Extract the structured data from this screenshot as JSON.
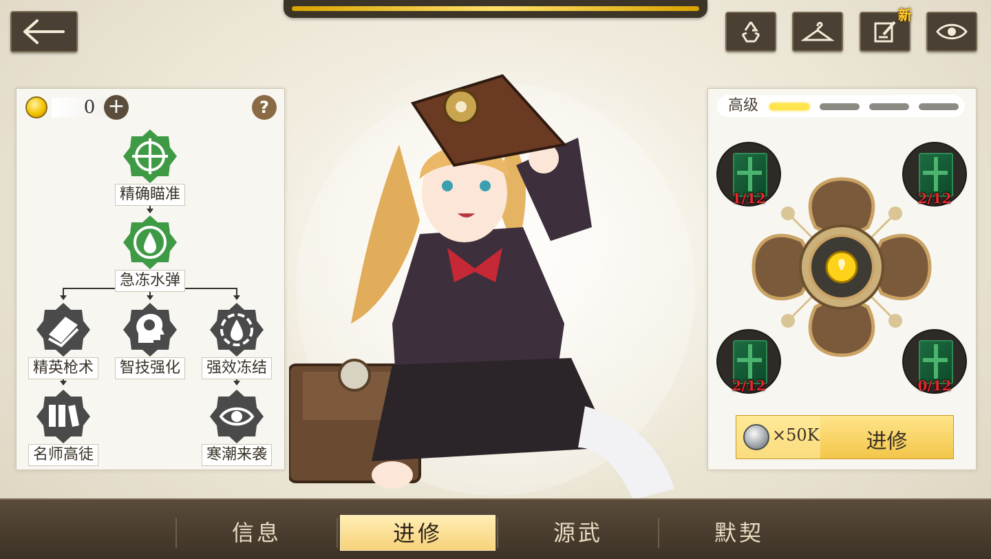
{
  "topbar": {
    "new_badge": "新"
  },
  "icons": {
    "back": "back-arrow-icon",
    "recycle": "recycle-icon",
    "wardrobe": "hanger-icon",
    "notes": "edit-note-icon",
    "view": "eye-icon"
  },
  "left_panel": {
    "resource_value": "0",
    "plus_label": "+",
    "help_label": "?",
    "skills": [
      {
        "label": "精确瞄准"
      },
      {
        "label": "急冻水弹"
      },
      {
        "label": "精英枪术"
      },
      {
        "label": "智技强化"
      },
      {
        "label": "强效冻结"
      },
      {
        "label": "名师高徒"
      },
      {
        "label": "寒潮来袭"
      }
    ]
  },
  "right_panel": {
    "level_label": "高级",
    "level_segments": 4,
    "level_active": 1,
    "materials": [
      {
        "count": "1/12"
      },
      {
        "count": "2/12"
      },
      {
        "count": "2/12"
      },
      {
        "count": "0/12"
      }
    ],
    "upgrade_cost": "×50K",
    "upgrade_label": "进修"
  },
  "tabs": [
    {
      "label": "信息"
    },
    {
      "label": "进修"
    },
    {
      "label": "源武"
    },
    {
      "label": "默契"
    }
  ],
  "colors": {
    "accent_gold": "#ffd84a",
    "skill_green": "#3f9a45",
    "skill_gray": "#4a4a4a",
    "count_red": "#e8282a"
  }
}
